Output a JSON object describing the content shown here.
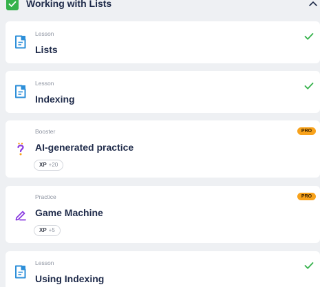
{
  "section": {
    "title": "Working with Lists",
    "completed": true,
    "expanded": true
  },
  "items": [
    {
      "type": "Lesson",
      "title": "Lists",
      "icon": "lesson-icon",
      "completed": true
    },
    {
      "type": "Lesson",
      "title": "Indexing",
      "icon": "lesson-icon",
      "completed": true
    },
    {
      "type": "Booster",
      "title": "AI-generated practice",
      "icon": "booster-icon",
      "badge": "PRO",
      "xp_label": "XP",
      "xp_value": "+20"
    },
    {
      "type": "Practice",
      "title": "Game Machine",
      "icon": "practice-icon",
      "badge": "PRO",
      "xp_label": "XP",
      "xp_value": "+5"
    },
    {
      "type": "Lesson",
      "title": "Using Indexing",
      "icon": "lesson-icon",
      "completed": true
    }
  ],
  "colors": {
    "done_green": "#35b24b",
    "pro_orange": "#f8a21b",
    "lesson_blue": "#2d8fd9",
    "booster_purple": "#8a3be0"
  }
}
